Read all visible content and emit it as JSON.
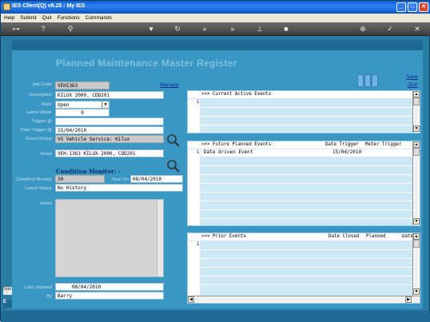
{
  "window": {
    "title": "IES Client(Q) v8.25 : My IES"
  },
  "menu": [
    "Help",
    "Submit",
    "Quit",
    "Functions",
    "Commands"
  ],
  "toolbar": [
    {
      "icon": "key-icon",
      "glyph": "⊶"
    },
    {
      "icon": "help-icon",
      "glyph": "?"
    },
    {
      "icon": "search-icon",
      "glyph": "⚲"
    },
    {
      "icon": "heart-icon",
      "glyph": "♥"
    },
    {
      "icon": "refresh-icon",
      "glyph": "↻"
    },
    {
      "icon": "rewind-icon",
      "glyph": "«"
    },
    {
      "icon": "forward-icon",
      "glyph": "»"
    },
    {
      "icon": "pin-icon",
      "glyph": "⊥"
    },
    {
      "icon": "stop-icon",
      "glyph": "■"
    },
    {
      "icon": "add-icon",
      "glyph": "⊕"
    },
    {
      "icon": "check-icon",
      "glyph": "✓"
    },
    {
      "icon": "close-icon",
      "glyph": "✕"
    }
  ],
  "page": {
    "title": "Planned Maintenance Master Register"
  },
  "actions": {
    "save": "Save",
    "quit": "Quit",
    "manage": "Manage"
  },
  "form": {
    "job_code": {
      "label": "Job Code",
      "value": "VEH1363"
    },
    "description": {
      "label": "Description",
      "value": "KILUX 2000, CDD201"
    },
    "state": {
      "label": "State",
      "value": "Open"
    },
    "latest_meter": {
      "label": "Latest Meter",
      "value": "0"
    },
    "trigger": {
      "label": "Trigger @",
      "value": ""
    },
    "date_trigger": {
      "label": "Date Trigger @",
      "value": "15/04/2010"
    },
    "event_group": {
      "label": "Event Group",
      "value": "VS Vehicle Service: Kilux"
    },
    "asset": {
      "label": "Asset",
      "value": "VEH-1363 KILUX 2000, CDD201"
    },
    "condition_title": "Condition Monitor: -",
    "condition_monitor": {
      "label": "Condition Monitor",
      "value": "30"
    },
    "next_on": {
      "label": "Next On",
      "value": "08/04/2010"
    },
    "latest_status": {
      "label": "Latest Status",
      "value": "No History"
    },
    "notes": {
      "label": "Notes",
      "value": ""
    },
    "last_updated": {
      "label": "Last Updated",
      "value": "08/04/2010"
    },
    "by": {
      "label": "By",
      "value": "Barry"
    }
  },
  "grids": {
    "current": {
      "header": ">>> Current Active Events",
      "marker": "i"
    },
    "future": {
      "header": ">>> Future Planned Events",
      "col_date": "Date Trigger",
      "col_meter": "Meter Trigger",
      "marker": "i",
      "rows": [
        {
          "event": "Date driven Event",
          "date": "15/04/2010"
        }
      ]
    },
    "prior": {
      "header": ">>> Prior Events",
      "col_closed": "Date Closed",
      "col_planned": "Planned",
      "col_date": "Date",
      "marker": "i"
    }
  },
  "side_tags": {
    "sav": "Sav",
    "e": "E"
  }
}
